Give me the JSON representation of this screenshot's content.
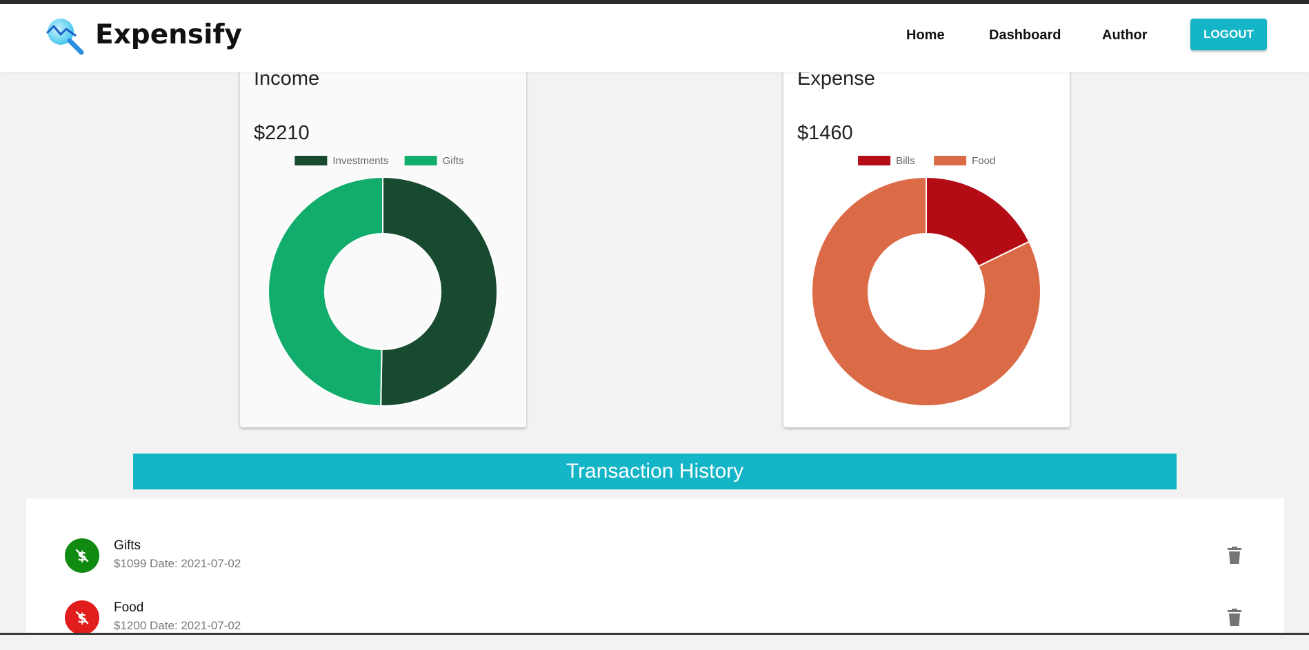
{
  "header": {
    "brand": "Expensify",
    "nav": [
      {
        "label": "Home"
      },
      {
        "label": "Dashboard"
      },
      {
        "label": "Author"
      }
    ],
    "logout_label": "LOGOUT",
    "logo_icon": "chart-search-icon"
  },
  "income": {
    "title": "Income",
    "amount": "$2210",
    "chart_data": {
      "type": "pie",
      "categories": [
        "Investments",
        "Gifts"
      ],
      "values": [
        1111,
        1099
      ],
      "colors": [
        "#184a30",
        "#12ad6c"
      ],
      "legend": "top"
    }
  },
  "expense": {
    "title": "Expense",
    "amount": "$1460",
    "chart_data": {
      "type": "pie",
      "categories": [
        "Bills",
        "Food"
      ],
      "values": [
        260,
        1200
      ],
      "colors": [
        "#b30c15",
        "#db6a47"
      ],
      "legend": "top"
    }
  },
  "history": {
    "title": "Transaction History",
    "items": [
      {
        "title": "Gifts",
        "sub": "$1099 Date: 2021-07-02",
        "type": "income",
        "color": "#108a10"
      },
      {
        "title": "Food",
        "sub": "$1200 Date: 2021-07-02",
        "type": "expense",
        "color": "#e11d1d"
      }
    ]
  }
}
